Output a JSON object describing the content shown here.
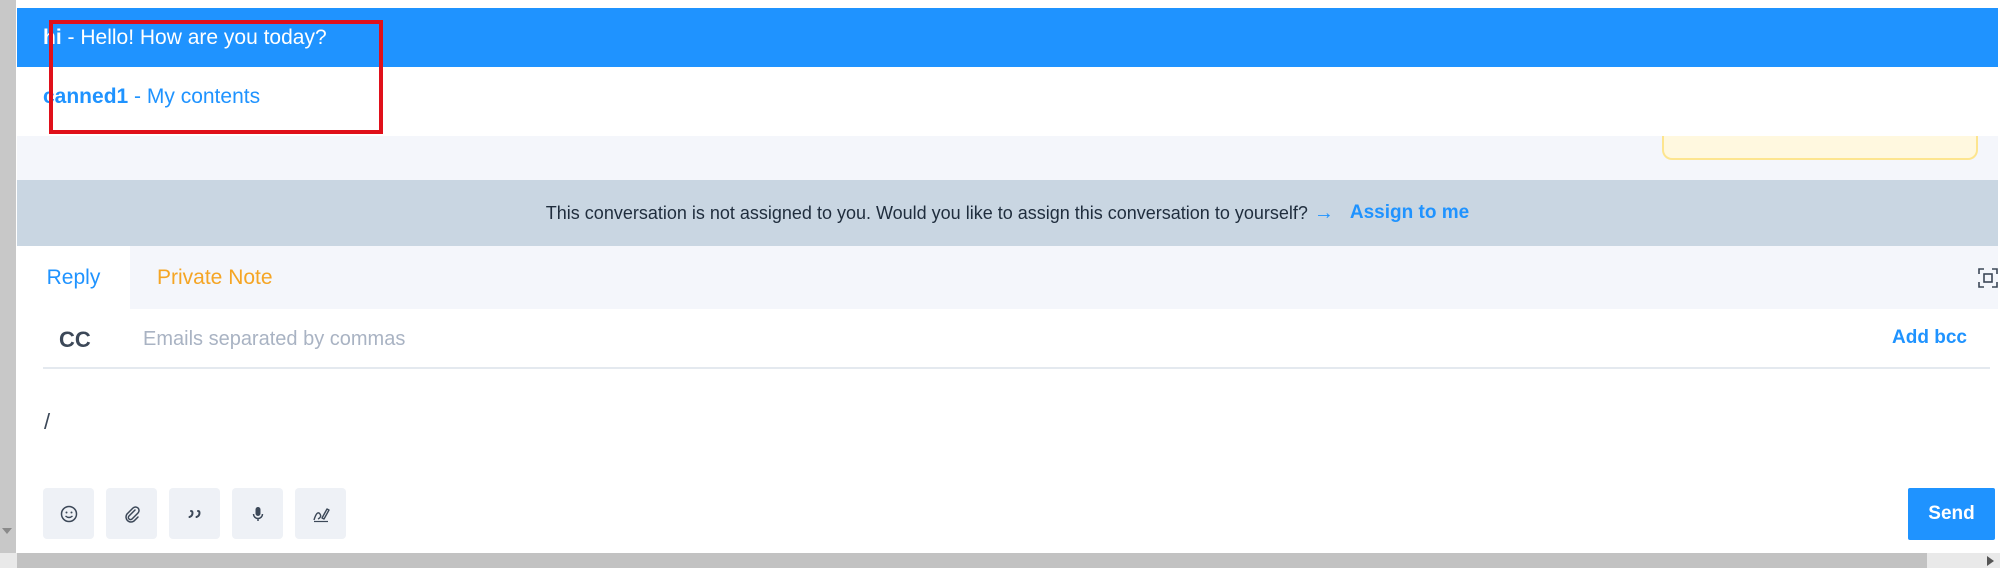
{
  "canned_responses": [
    {
      "code": "hi",
      "separator": " - ",
      "content": "Hello! How are you today?"
    },
    {
      "code": "canned1",
      "separator": " - ",
      "content": "My contents"
    }
  ],
  "banner": {
    "message": "This conversation is not assigned to you. Would you like to assign this conversation to yourself?",
    "arrow": "→",
    "assign_label": "Assign to me"
  },
  "tabs": {
    "reply_label": "Reply",
    "private_note_label": "Private Note"
  },
  "cc": {
    "label": "CC",
    "placeholder": "Emails separated by commas",
    "add_bcc_label": "Add bcc"
  },
  "editor": {
    "text": "/"
  },
  "toolbar": {
    "icons": [
      "emoji-icon",
      "attachment-icon",
      "quote-icon",
      "microphone-icon",
      "signature-icon"
    ],
    "send_label": "Send"
  },
  "colors": {
    "accent": "#1f93ff",
    "warning": "#f5a524",
    "highlight": "#e0101a",
    "banner_bg": "#c9d6e2"
  }
}
